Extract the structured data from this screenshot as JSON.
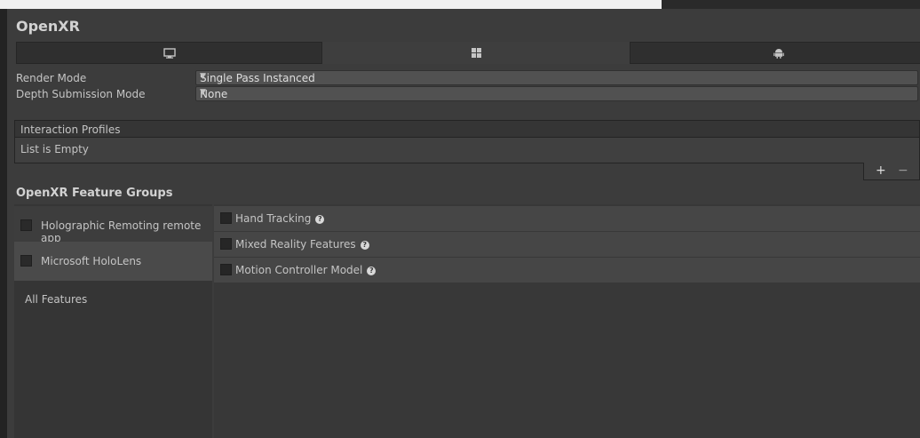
{
  "title": "OpenXR",
  "tabs": [
    {
      "name": "Standalone",
      "icon": "monitor-icon"
    },
    {
      "name": "Universal Windows Platform",
      "icon": "windows-icon"
    },
    {
      "name": "Android",
      "icon": "android-icon"
    }
  ],
  "settings": {
    "render_mode": {
      "label": "Render Mode",
      "value": "Single Pass Instanced"
    },
    "depth_submission_mode": {
      "label": "Depth Submission Mode",
      "value": "None"
    }
  },
  "interaction_profiles": {
    "header": "Interaction Profiles",
    "empty_text": "List is Empty",
    "add_label": "+",
    "remove_label": "−"
  },
  "feature_groups": {
    "title": "OpenXR Feature Groups",
    "groups": [
      {
        "label": "Holographic Remoting remote app",
        "checked": false
      },
      {
        "label": "Microsoft HoloLens",
        "checked": false
      }
    ],
    "all_features_label": "All Features"
  },
  "features": [
    {
      "label": "Hand Tracking",
      "checked": false
    },
    {
      "label": "Mixed Reality Features",
      "checked": false
    },
    {
      "label": "Motion Controller Model",
      "checked": false
    }
  ],
  "colors": {
    "background": "#383838",
    "panel": "#3c3c3c",
    "field": "#515151",
    "text": "#c4c4c4"
  }
}
